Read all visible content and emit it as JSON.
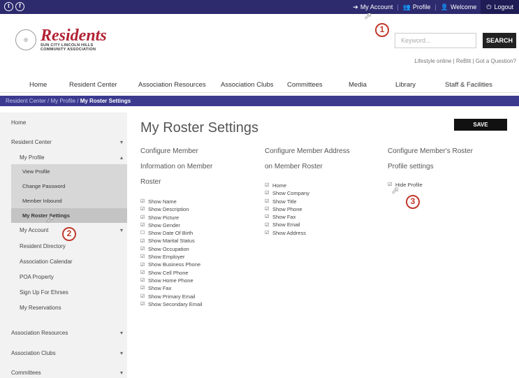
{
  "topbar": {
    "social": [
      "t",
      "f"
    ],
    "links": [
      "My Account",
      "Profile",
      "Welcome"
    ],
    "logout": "Logout"
  },
  "logo": {
    "brand": "Residents",
    "line1": "SUN CITY LINCOLN HILLS",
    "line2": "COMMUNITY ASSOCIATION"
  },
  "search": {
    "placeholder": "Keyword...",
    "button": "SEARCH"
  },
  "utility_links": "Lifestyle online  |  ReBlit  |  Got a Question?",
  "mainnav": [
    "Home",
    "Resident Center",
    "Association Resources",
    "Association Clubs",
    "Committees",
    "Media",
    "Library",
    "Staff & Facilities"
  ],
  "breadcrumb": {
    "path": "Resident Center / My Profile / ",
    "current": "My Roster Settings"
  },
  "sidebar": {
    "home": "Home",
    "resident_center": "Resident Center",
    "my_profile": "My Profile",
    "profile_sub": [
      "View Profile",
      "Change Password",
      "Member Inbound",
      "My Roster Settings"
    ],
    "my_account": "My Account",
    "items": [
      "Resident Directory",
      "Association Calendar",
      "POA Property",
      "Sign Up For Ehrses",
      "My Reservations"
    ],
    "sections": [
      "Association Resources",
      "Association Clubs",
      "Committees"
    ]
  },
  "page": {
    "title": "My Roster Settings",
    "save": "SAVE"
  },
  "col1": {
    "heading": [
      "Configure Member",
      "Information on Member",
      "Roster"
    ],
    "items": [
      {
        "label": "Show Name",
        "checked": true
      },
      {
        "label": "Show Description",
        "checked": true
      },
      {
        "label": "Show Picture",
        "checked": true
      },
      {
        "label": "Show Gender",
        "checked": true
      },
      {
        "label": "Show Date Of Birth",
        "checked": false
      },
      {
        "label": "Show Marital Status",
        "checked": true
      },
      {
        "label": "Show Occupation",
        "checked": true
      },
      {
        "label": "Show Employer",
        "checked": true
      },
      {
        "label": "Show Business Phone",
        "checked": true
      },
      {
        "label": "Show Cell Phone",
        "checked": true
      },
      {
        "label": "Show Home Phone",
        "checked": true
      },
      {
        "label": "Show Fax",
        "checked": true
      },
      {
        "label": "Show Primary Email",
        "checked": true
      },
      {
        "label": "Show Secondary Email",
        "checked": true
      }
    ]
  },
  "col2": {
    "heading": [
      "Configure Member Address",
      "on Member Roster"
    ],
    "items": [
      {
        "label": "Home",
        "checked": true
      },
      {
        "label": "Show Company",
        "checked": true
      },
      {
        "label": "Show Title",
        "checked": true
      },
      {
        "label": "Show Phone",
        "checked": true
      },
      {
        "label": "Show Fax",
        "checked": true
      },
      {
        "label": "Show Email",
        "checked": true
      },
      {
        "label": "Show Address",
        "checked": true
      }
    ]
  },
  "col3": {
    "heading": [
      "Configure Member's Roster",
      "Profile settings"
    ],
    "items": [
      {
        "label": "Hide Profile",
        "checked": true
      }
    ]
  },
  "callouts": [
    "1",
    "2",
    "3"
  ],
  "colors": {
    "topbar": "#2d2a6e",
    "breadcrumb": "#3b3a8f",
    "brand_red": "#b22234",
    "callout": "#c0392b"
  }
}
